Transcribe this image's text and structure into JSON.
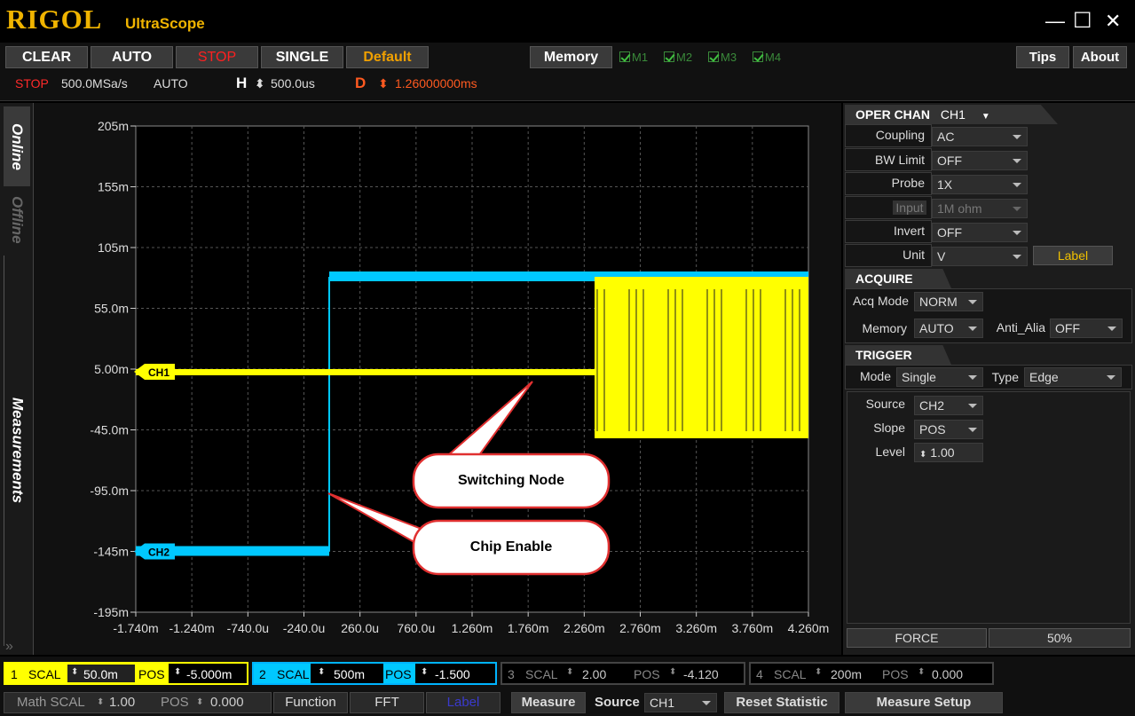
{
  "app": {
    "brand": "RIGOL",
    "product": "UltraScope"
  },
  "window": {
    "minimize": "—",
    "maximize": "☐",
    "close": "✕"
  },
  "toolbar": {
    "clear": "CLEAR",
    "auto": "AUTO",
    "stop": "STOP",
    "single": "SINGLE",
    "default": "Default",
    "memory": "Memory",
    "m1": "M1",
    "m2": "M2",
    "m3": "M3",
    "m4": "M4",
    "tips": "Tips",
    "about": "About"
  },
  "status": {
    "run_state": "STOP",
    "sample_rate": "500.0MSa/s",
    "mode": "AUTO",
    "h_label": "H",
    "h_value": "500.0us",
    "d_label": "D",
    "d_value": "1.26000000ms"
  },
  "side_tabs": {
    "online": "Online",
    "offline": "Offline",
    "measurements": "Measurements"
  },
  "chart_data": {
    "type": "line",
    "y_ticks": [
      "205m",
      "155m",
      "105m",
      "55.0m",
      "5.00m",
      "-45.0m",
      "-95.0m",
      "-145m",
      "-195m"
    ],
    "x_ticks": [
      "-1.740m",
      "-1.240m",
      "-740.0u",
      "-240.0u",
      "260.0u",
      "760.0u",
      "1.260m",
      "1.760m",
      "2.260m",
      "2.760m",
      "3.260m",
      "3.760m",
      "4.260m"
    ],
    "grid": true,
    "series": [
      {
        "name": "CH1",
        "color": "#ffff00",
        "marker_y": "5.00m"
      },
      {
        "name": "CH2",
        "color": "#00c8ff",
        "marker_y": "-145m"
      }
    ],
    "annotations": [
      "Switching Node",
      "Chip Enable"
    ]
  },
  "oper_chan": {
    "title": "OPER CHAN",
    "channel": "CH1",
    "coupling_label": "Coupling",
    "coupling": "AC",
    "bw_label": "BW Limit",
    "bw": "OFF",
    "probe_label": "Probe",
    "probe": "1X",
    "input_label": "Input",
    "input": "1M ohm",
    "invert_label": "Invert",
    "invert": "OFF",
    "unit_label": "Unit",
    "unit": "V",
    "label_btn": "Label"
  },
  "acquire": {
    "title": "ACQUIRE",
    "acq_mode_label": "Acq Mode",
    "acq_mode": "NORM",
    "memory_label": "Memory",
    "memory": "AUTO",
    "anti_label": "Anti_Alia",
    "anti": "OFF"
  },
  "trigger": {
    "title": "TRIGGER",
    "mode_label": "Mode",
    "mode": "Single",
    "type_label": "Type",
    "type": "Edge",
    "source_label": "Source",
    "source": "CH2",
    "slope_label": "Slope",
    "slope": "POS",
    "level_label": "Level",
    "level": "1.00",
    "force": "FORCE",
    "fifty": "50%"
  },
  "channels": [
    {
      "num": "1",
      "scal_label": "SCAL",
      "scal": "50.0m",
      "pos_label": "POS",
      "pos": "-5.000m"
    },
    {
      "num": "2",
      "scal_label": "SCAL",
      "scal": "500m",
      "pos_label": "POS",
      "pos": "-1.500"
    },
    {
      "num": "3",
      "scal_label": "SCAL",
      "scal": "2.00",
      "pos_label": "POS",
      "pos": "-4.120"
    },
    {
      "num": "4",
      "scal_label": "SCAL",
      "scal": "200m",
      "pos_label": "POS",
      "pos": "0.000"
    }
  ],
  "math": {
    "scal_label": "Math SCAL",
    "scal": "1.00",
    "pos_label": "POS",
    "pos": "0.000"
  },
  "bottom_bar": {
    "function": "Function",
    "fft": "FFT",
    "label": "Label",
    "measure": "Measure",
    "source_label": "Source",
    "source": "CH1",
    "reset_statistic": "Reset  Statistic",
    "measure_setup": "Measure Setup"
  }
}
